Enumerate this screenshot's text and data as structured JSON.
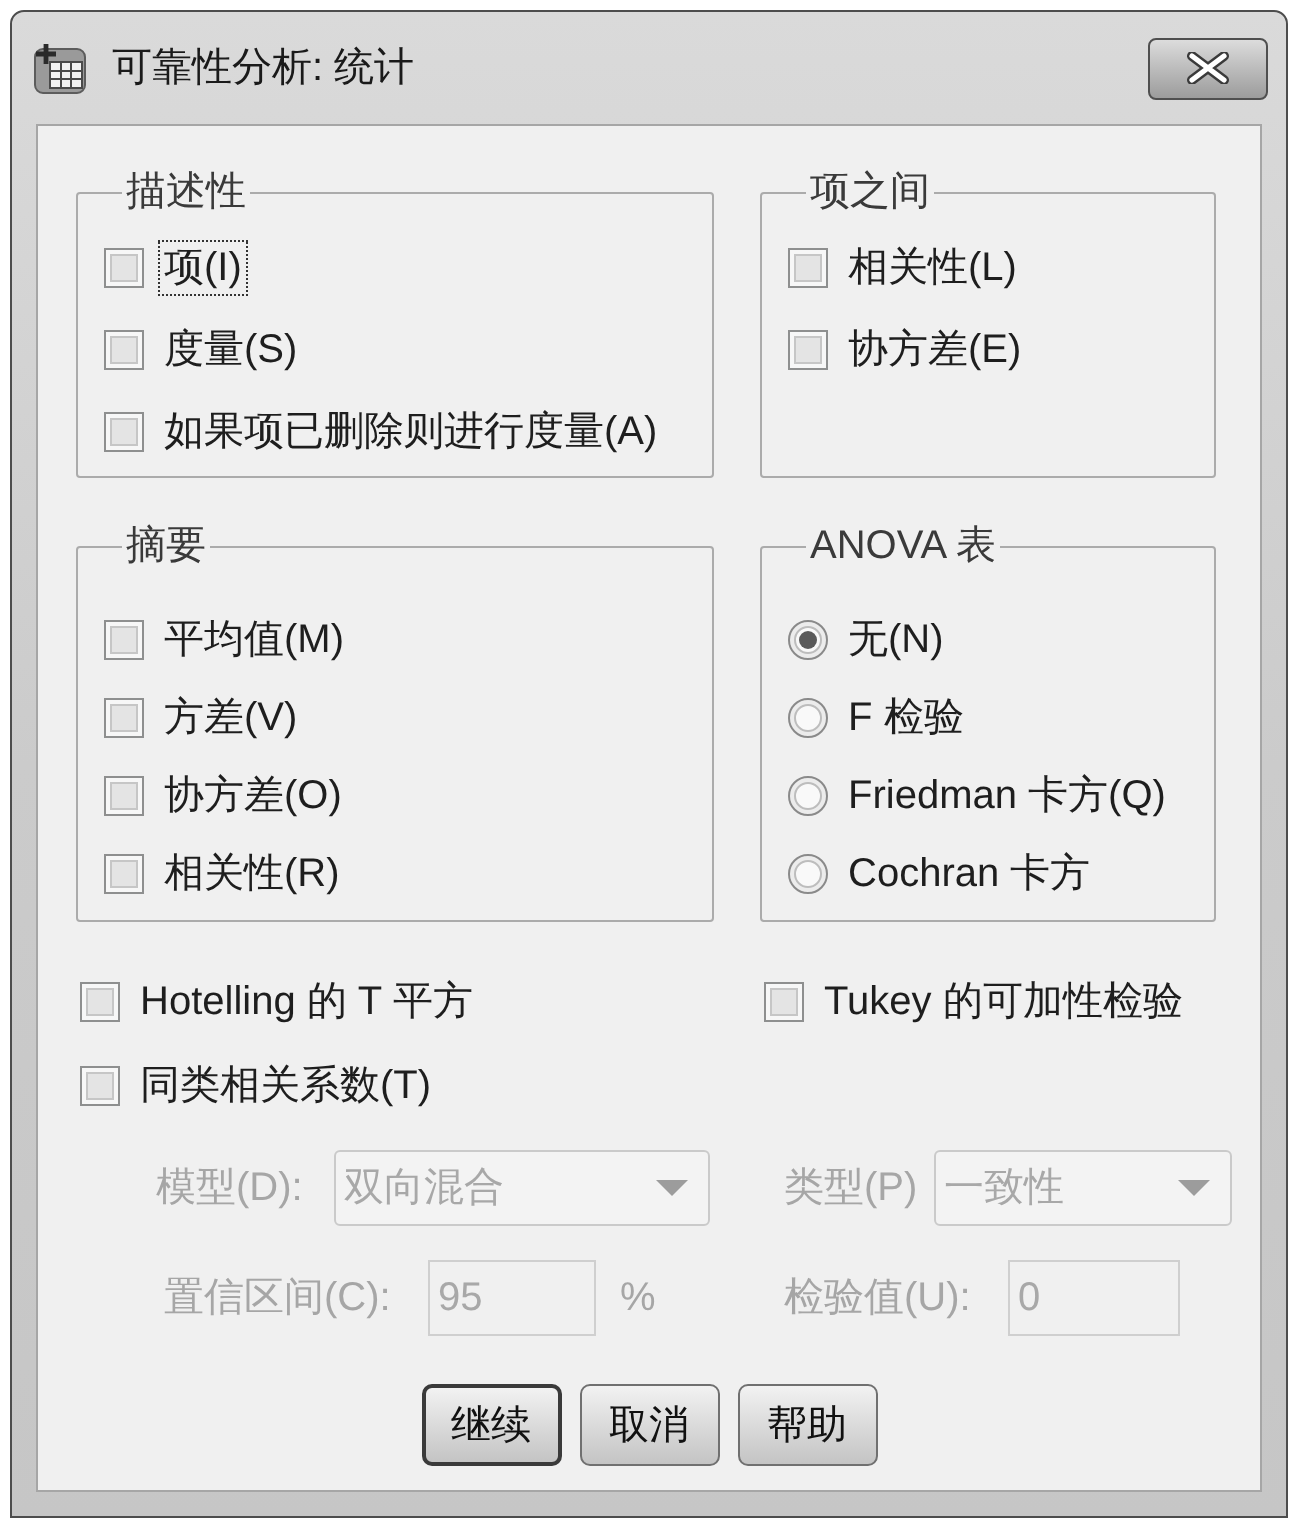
{
  "window": {
    "title": "可靠性分析: 统计"
  },
  "descriptives": {
    "title": "描述性",
    "items": [
      {
        "label": "项(I)",
        "checked": false,
        "focused": true
      },
      {
        "label": "度量(S)",
        "checked": false,
        "focused": false
      },
      {
        "label": "如果项已删除则进行度量(A)",
        "checked": false,
        "focused": false
      }
    ]
  },
  "inter_item": {
    "title": "项之间",
    "items": [
      {
        "label": "相关性(L)",
        "checked": false,
        "focused": false
      },
      {
        "label": "协方差(E)",
        "checked": false,
        "focused": false
      }
    ]
  },
  "summaries": {
    "title": "摘要",
    "items": [
      {
        "label": "平均值(M)",
        "checked": false,
        "focused": false
      },
      {
        "label": "方差(V)",
        "checked": false,
        "focused": false
      },
      {
        "label": "协方差(O)",
        "checked": false,
        "focused": false
      },
      {
        "label": "相关性(R)",
        "checked": false,
        "focused": false
      }
    ]
  },
  "anova_table": {
    "title": "ANOVA 表",
    "options": [
      {
        "label": "无(N)",
        "selected": true
      },
      {
        "label": "F 检验",
        "selected": false
      },
      {
        "label": "Friedman 卡方(Q)",
        "selected": false
      },
      {
        "label": "Cochran 卡方",
        "selected": false
      }
    ]
  },
  "options": [
    {
      "label": "Hotelling 的 T 平方",
      "checked": false,
      "focused": false
    },
    {
      "label": "Tukey 的可加性检验",
      "checked": false,
      "focused": false
    },
    {
      "label": "同类相关系数(T)",
      "checked": false,
      "focused": false
    }
  ],
  "icc": {
    "model": {
      "label": "模型(D):",
      "value": "双向混合",
      "disabled": true
    },
    "type": {
      "label": "类型(P)",
      "value": "一致性",
      "disabled": true
    },
    "confidence_interval": {
      "label": "置信区间(C):",
      "value": "95",
      "unit": "%",
      "disabled": true
    },
    "test_value": {
      "label": "检验值(U):",
      "value": "0",
      "disabled": true
    }
  },
  "buttons": [
    {
      "label": "继续",
      "default": true
    },
    {
      "label": "取消",
      "default": false
    },
    {
      "label": "帮助",
      "default": false
    }
  ]
}
